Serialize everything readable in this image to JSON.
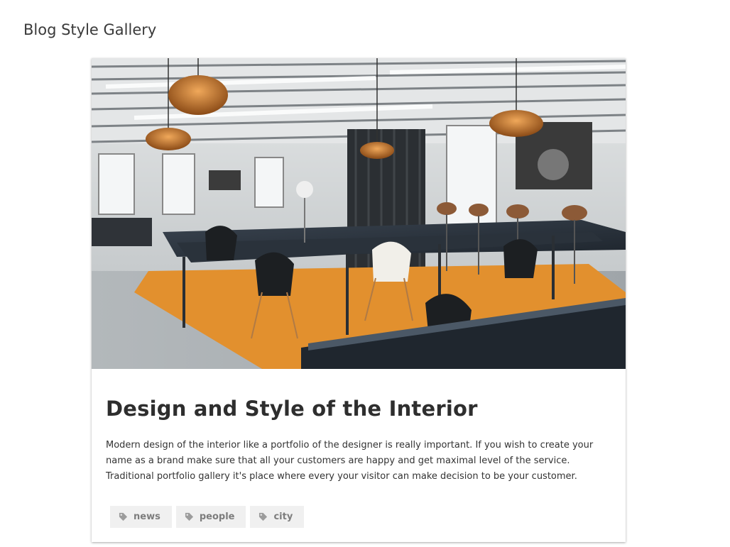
{
  "page": {
    "title": "Blog Style Gallery"
  },
  "post": {
    "image_alt": "Open-plan office interior with copper pendant lamps, black desks and chairs on an orange rug",
    "title": "Design and Style of the Interior",
    "excerpt": "Modern design of the interior like a portfolio of the designer is really important. If you wish to create your name as a brand make sure that all your customers are happy and get maximal level of the service. Traditional portfolio gallery it's place where every your visitor can make decision to be your customer.",
    "tags": [
      {
        "label": "news",
        "icon": "tag-icon"
      },
      {
        "label": "people",
        "icon": "tag-icon"
      },
      {
        "label": "city",
        "icon": "tag-icon"
      }
    ]
  },
  "colors": {
    "tag_bg": "#f0f0f0",
    "tag_text": "#7d7d7d",
    "rug": "#e2902e"
  }
}
